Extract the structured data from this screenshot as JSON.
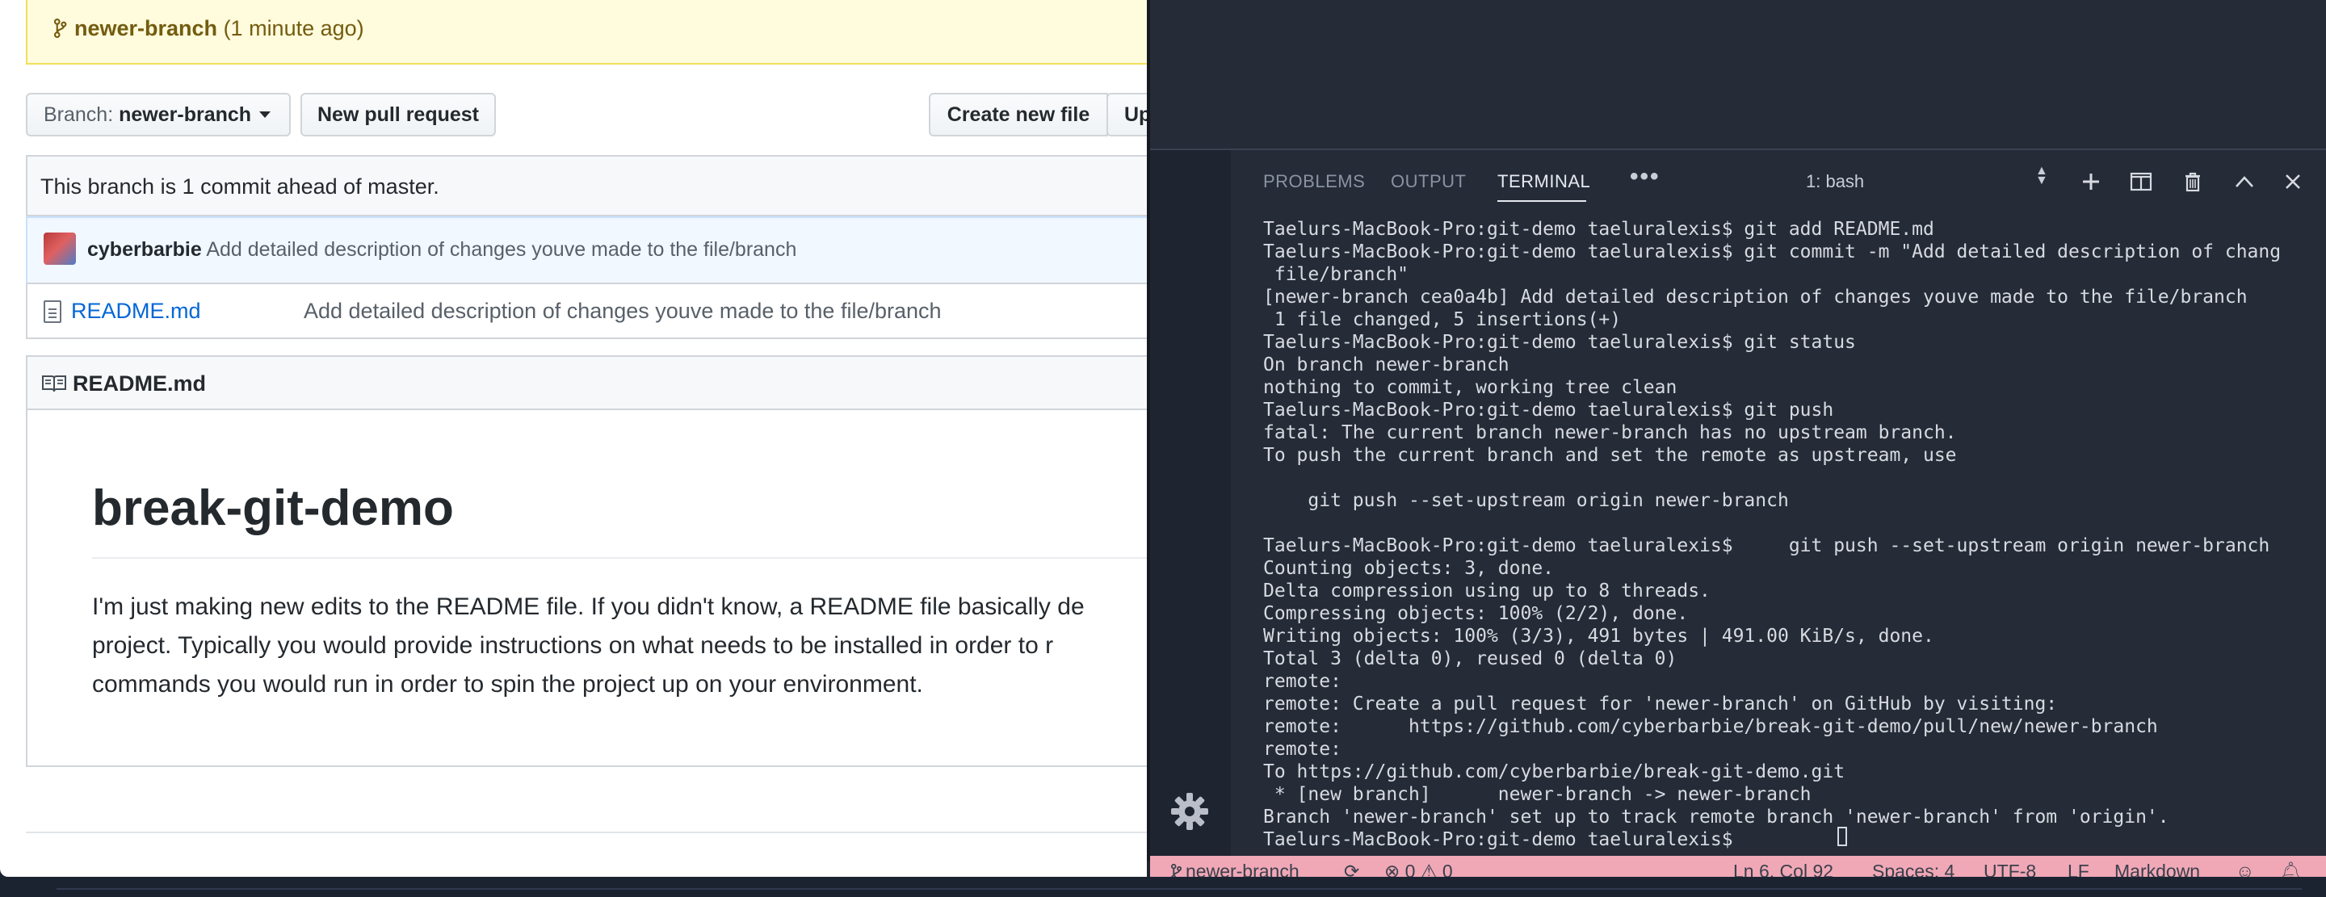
{
  "github": {
    "banner": {
      "branch": "newer-branch",
      "time": "(1 minute ago)"
    },
    "toolbar": {
      "branch_label": "Branch:",
      "branch_value": "newer-branch",
      "new_pr_label": "New pull request",
      "create_file_label": "Create new file",
      "upload_label": "Up"
    },
    "ahead_text": "This branch is 1 commit ahead of master.",
    "latest_commit": {
      "author": "cyberbarbie",
      "message": "Add detailed description of changes youve made to the file/branch"
    },
    "files": [
      {
        "name": "README.md",
        "message": "Add detailed description of changes youve made to the file/branch"
      }
    ],
    "readme": {
      "header": "README.md",
      "title": "break-git-demo",
      "paragraph_lines": [
        "I'm just making new edits to the README file. If you didn't know, a README file basically de",
        "project. Typically you would provide instructions on what needs to be installed in order to r",
        "commands you would run in order to spin the project up on your environment."
      ]
    }
  },
  "vscode": {
    "panel_tabs": [
      "PROBLEMS",
      "OUTPUT",
      "TERMINAL"
    ],
    "active_tab": "TERMINAL",
    "more_label": "•••",
    "terminal_selector": "1: bash",
    "terminal_lines": [
      "Taelurs-MacBook-Pro:git-demo taeluralexis$ git add README.md",
      "Taelurs-MacBook-Pro:git-demo taeluralexis$ git commit -m \"Add detailed description of chang",
      " file/branch\"",
      "[newer-branch cea0a4b] Add detailed description of changes youve made to the file/branch",
      " 1 file changed, 5 insertions(+)",
      "Taelurs-MacBook-Pro:git-demo taeluralexis$ git status",
      "On branch newer-branch",
      "nothing to commit, working tree clean",
      "Taelurs-MacBook-Pro:git-demo taeluralexis$ git push",
      "fatal: The current branch newer-branch has no upstream branch.",
      "To push the current branch and set the remote as upstream, use",
      "",
      "    git push --set-upstream origin newer-branch",
      "",
      "Taelurs-MacBook-Pro:git-demo taeluralexis$     git push --set-upstream origin newer-branch",
      "Counting objects: 3, done.",
      "Delta compression using up to 8 threads.",
      "Compressing objects: 100% (2/2), done.",
      "Writing objects: 100% (3/3), 491 bytes | 491.00 KiB/s, done.",
      "Total 3 (delta 0), reused 0 (delta 0)",
      "remote:",
      "remote: Create a pull request for 'newer-branch' on GitHub by visiting:",
      "remote:      https://github.com/cyberbarbie/break-git-demo/pull/new/newer-branch",
      "remote:",
      "To https://github.com/cyberbarbie/break-git-demo.git",
      " * [new branch]      newer-branch -> newer-branch",
      "Branch 'newer-branch' set up to track remote branch 'newer-branch' from 'origin'.",
      "Taelurs-MacBook-Pro:git-demo taeluralexis$ "
    ],
    "statusbar": {
      "branch": "newer-branch",
      "errors": "0",
      "warnings": "0",
      "position": "Ln 6, Col 92",
      "spaces": "Spaces: 4",
      "encoding": "UTF-8",
      "eol": "LF",
      "language": "Markdown"
    },
    "colors": {
      "statusbar_bg": "#f0a8b7",
      "terminal_bg": "#252b37"
    }
  }
}
